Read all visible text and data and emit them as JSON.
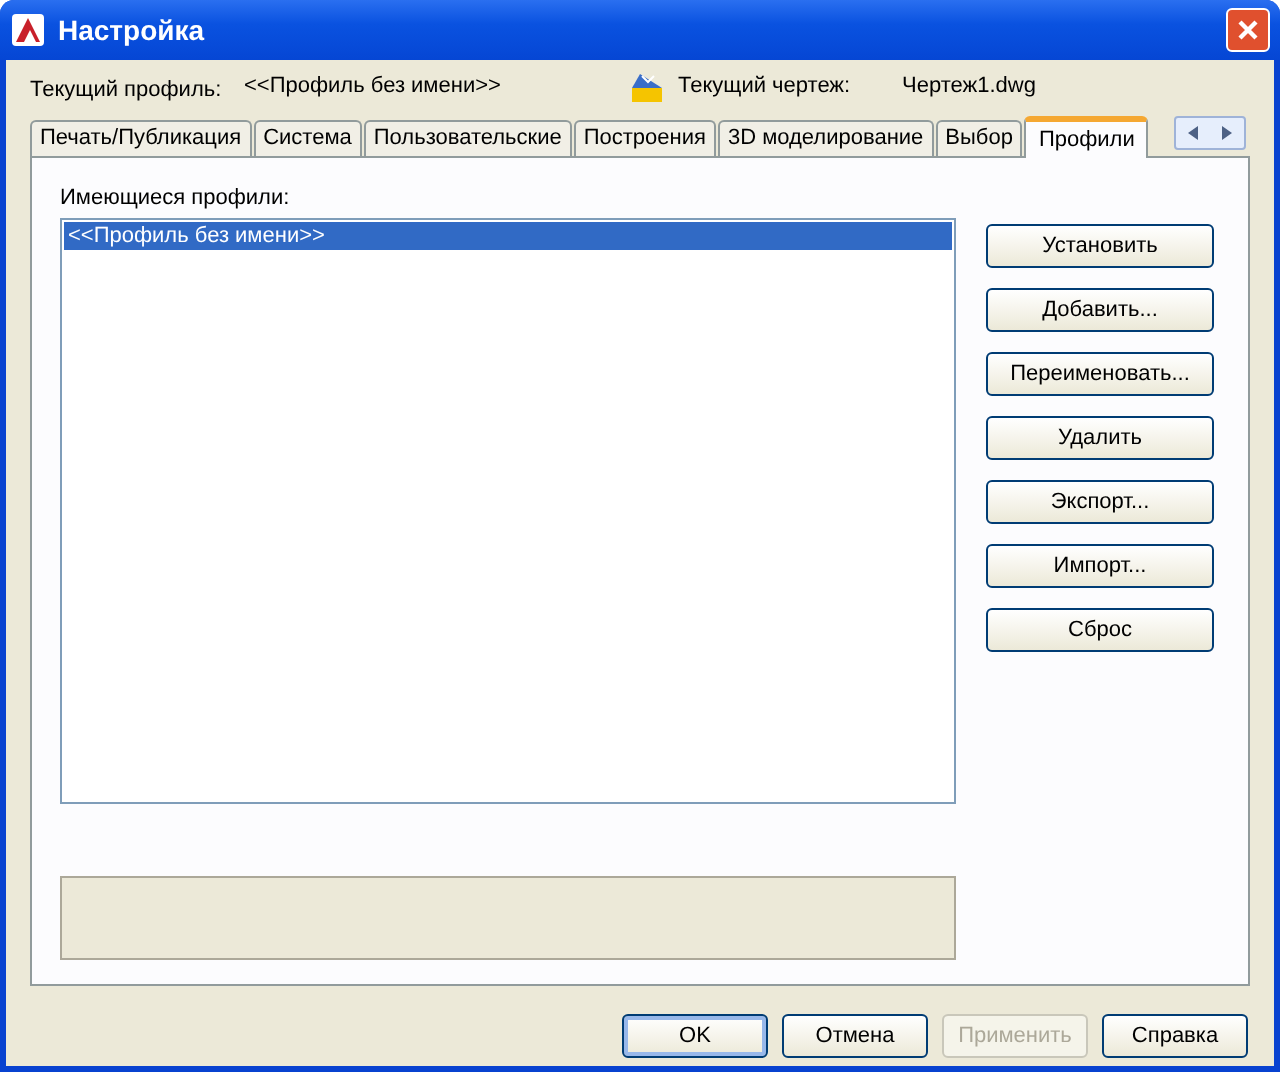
{
  "window": {
    "title": "Настройка"
  },
  "header": {
    "profile_label": "Текущий профиль:",
    "profile_value": "<<Профиль без имени>>",
    "drawing_label": "Текущий чертеж:",
    "drawing_value": "Чертеж1.dwg"
  },
  "tabs": [
    {
      "label": "Печать/Публикация",
      "selected": false
    },
    {
      "label": "Система",
      "selected": false
    },
    {
      "label": "Пользовательские",
      "selected": false
    },
    {
      "label": "Построения",
      "selected": false
    },
    {
      "label": "3D моделирование",
      "selected": false
    },
    {
      "label": "Выбор",
      "selected": false
    },
    {
      "label": "Профили",
      "selected": true
    }
  ],
  "profiles": {
    "label": "Имеющиеся профили:",
    "items": [
      {
        "name": "<<Профиль без имени>>",
        "selected": true
      }
    ]
  },
  "side_buttons": [
    "Установить",
    "Добавить...",
    "Переименовать...",
    "Удалить",
    "Экспорт...",
    "Импорт...",
    "Сброс"
  ],
  "footer_buttons": [
    {
      "label": "OK",
      "disabled": false,
      "default": true
    },
    {
      "label": "Отмена",
      "disabled": false,
      "default": false
    },
    {
      "label": "Применить",
      "disabled": true,
      "default": false
    },
    {
      "label": "Справка",
      "disabled": false,
      "default": false
    }
  ]
}
